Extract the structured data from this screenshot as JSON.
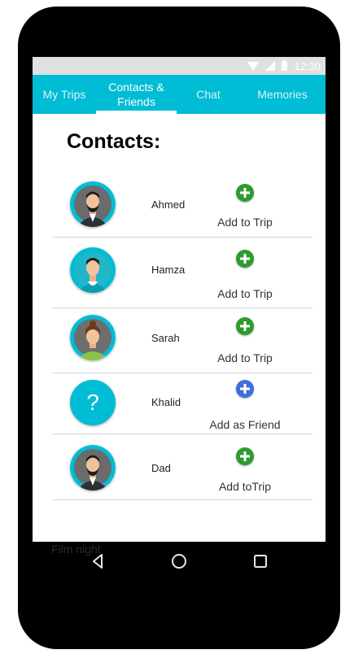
{
  "status": {
    "time": "12:30"
  },
  "tabs": [
    {
      "label": "My Trips"
    },
    {
      "label": "Contacts &\nFriends"
    },
    {
      "label": "Chat"
    },
    {
      "label": "Memories"
    }
  ],
  "heading": "Contacts:",
  "contacts": [
    {
      "name": "Ahmed",
      "action": "Add to Trip",
      "avatar": "man-beard-avatar"
    },
    {
      "name": "Hamza",
      "action": "Add to Trip",
      "avatar": "young-man-avatar"
    },
    {
      "name": "Sarah",
      "action": "Add to Trip",
      "avatar": "woman-avatar"
    },
    {
      "name": "Khalid",
      "action": "Add as Friend",
      "avatar": "unknown-user-question-icon"
    },
    {
      "name": "Dad",
      "action": "Add toTrip",
      "avatar": "man-beard-avatar"
    }
  ],
  "unknown_avatar_glyph": "?",
  "footer_ghost_text": "Film night",
  "colors": {
    "accent": "#00bcd4",
    "add_trip": "#2e9b2e",
    "add_friend": "#3f6fd8"
  }
}
